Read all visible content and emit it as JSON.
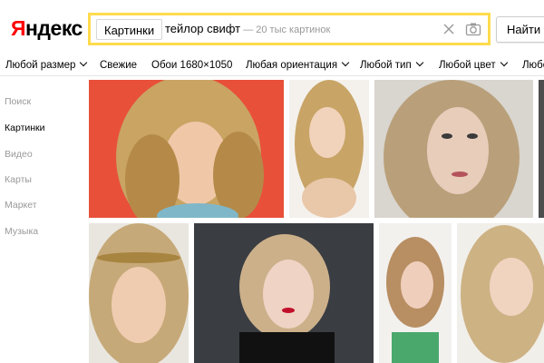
{
  "header": {
    "logo_first": "Я",
    "logo_rest": "ндекс",
    "service_label": "Картинки",
    "query": "тейлор свифт",
    "results_hint": " — 20 тыс картинок",
    "find_label": "Найти"
  },
  "filters": [
    {
      "label": "Любой размер",
      "dropdown": true
    },
    {
      "label": "Свежие",
      "dropdown": false
    },
    {
      "label": "Обои 1680×1050",
      "dropdown": false
    },
    {
      "label": "Любая ориентация",
      "dropdown": true
    },
    {
      "label": "Любой тип",
      "dropdown": true
    },
    {
      "label": "Любой цвет",
      "dropdown": true
    },
    {
      "label": "Любо",
      "dropdown": false
    }
  ],
  "sidebar": {
    "items": [
      {
        "label": "Поиск",
        "active": false
      },
      {
        "label": "Картинки",
        "active": true
      },
      {
        "label": "Видео",
        "active": false
      },
      {
        "label": "Карты",
        "active": false
      },
      {
        "label": "Маркет",
        "active": false
      },
      {
        "label": "Музыка",
        "active": false
      }
    ]
  },
  "colors": {
    "search_border": "#ffdb4d",
    "logo_accent": "#ff0000",
    "muted_text": "#999999"
  },
  "icons": [
    "clear-icon",
    "camera-icon",
    "chevron-down-icon"
  ]
}
